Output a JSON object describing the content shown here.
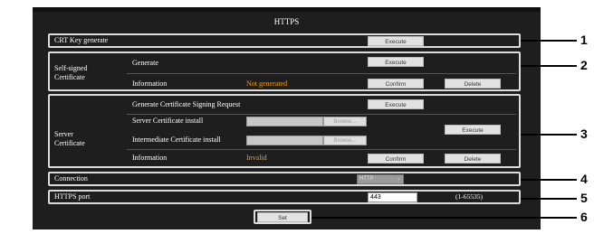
{
  "title": "HTTPS",
  "crt": {
    "label": "CRT Key generate",
    "execute_label": "Execute"
  },
  "self_signed": {
    "section_label_1": "Self-signed",
    "section_label_2": "Certificate",
    "generate_label": "Generate",
    "generate_button": "Execute",
    "info_label": "Information",
    "info_status": "Not generated",
    "confirm_button": "Confirm",
    "delete_button": "Delete"
  },
  "server": {
    "section_label_1": "Server",
    "section_label_2": "Certificate",
    "csr_label": "Generate Certificate Signing Request",
    "csr_button": "Execute",
    "install_label": "Server Certificate install",
    "intermediate_label": "Intermediate Certificate install",
    "browse_label": "Browse...",
    "install_execute": "Execute",
    "info_label": "Information",
    "info_status": "Invalid",
    "confirm_button": "Confirm",
    "delete_button": "Delete"
  },
  "connection": {
    "label": "Connection",
    "selected": "HTTP"
  },
  "port": {
    "label": "HTTPS port",
    "value": "443",
    "range": "(1-65535)"
  },
  "set_button": "Set",
  "callouts": [
    "1",
    "2",
    "3",
    "4",
    "5",
    "6"
  ],
  "colors": {
    "panel": "#1e1e1e",
    "status": "#f39c1b",
    "border": "#dcdcdc"
  }
}
